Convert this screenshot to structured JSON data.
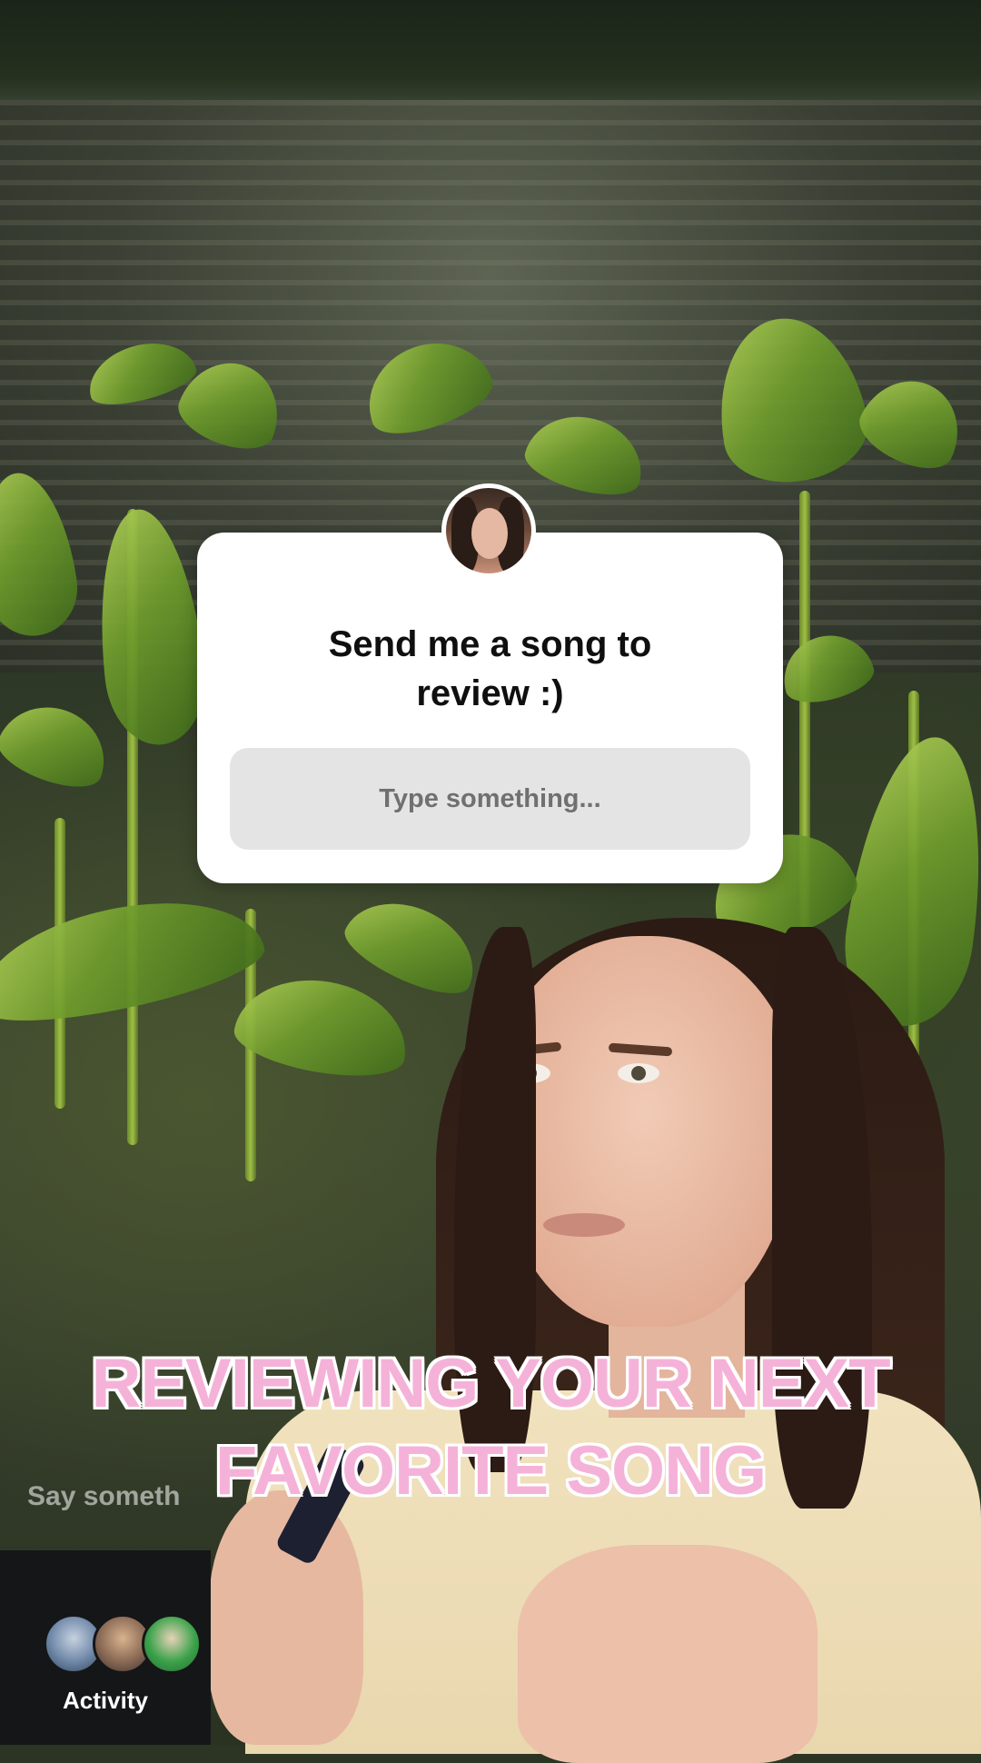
{
  "question_sticker": {
    "question": "Send me a song to\nreview :)",
    "input_placeholder": "Type something..."
  },
  "caption": {
    "text": "REVIEWING YOUR NEXT\nFAVORITE SONG"
  },
  "comment": {
    "placeholder": "Say someth"
  },
  "activity": {
    "label": "Activity",
    "avatars": [
      "viewer-avatar",
      "viewer-avatar",
      "viewer-avatar"
    ]
  },
  "colors": {
    "caption_fill": "#f5b2d8",
    "caption_outline": "#ffffff",
    "card_bg": "#ffffff",
    "input_bg": "#e4e4e4",
    "activity_bg": "#151618"
  }
}
